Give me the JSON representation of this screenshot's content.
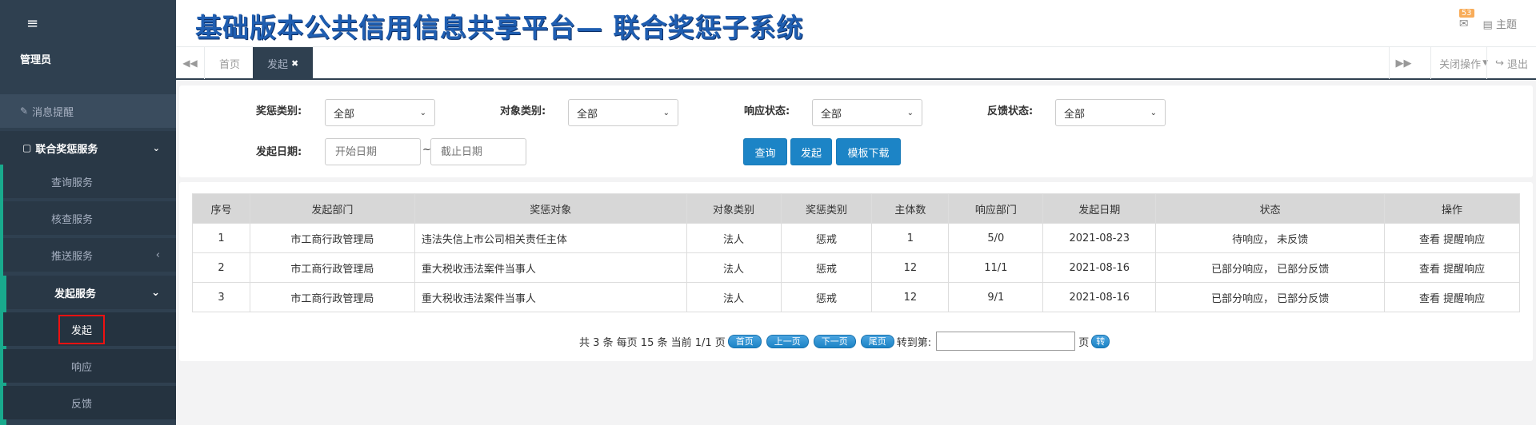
{
  "header": {
    "title": "基础版本公共信用信息共享平台— 联合奖惩子系统",
    "mail_badge": "53",
    "theme_label": "主题"
  },
  "sidebar": {
    "toggle_icon": "hamburger-icon",
    "user": "管理员",
    "message": "消息提醒",
    "group": "联合奖惩服务",
    "items": [
      "查询服务",
      "核查服务",
      "推送服务"
    ],
    "subgroup": "发起服务",
    "subitems": [
      "发起",
      "响应",
      "反馈"
    ]
  },
  "tabs": {
    "items": [
      "首页",
      "发起"
    ],
    "close_ops": "关闭操作",
    "logout": "退出"
  },
  "filter": {
    "reward_type_label": "奖惩类别:",
    "reward_type_value": "全部",
    "target_type_label": "对象类别:",
    "target_type_value": "全部",
    "response_status_label": "响应状态:",
    "response_status_value": "全部",
    "feedback_status_label": "反馈状态:",
    "feedback_status_value": "全部",
    "date_label": "发起日期:",
    "start_placeholder": "开始日期",
    "end_placeholder": "截止日期",
    "tilde": "~",
    "query_btn": "查询",
    "initiate_btn": "发起",
    "template_btn": "模板下载"
  },
  "table": {
    "headers": [
      "序号",
      "发起部门",
      "奖惩对象",
      "对象类别",
      "奖惩类别",
      "主体数",
      "响应部门",
      "发起日期",
      "状态",
      "操作"
    ],
    "rows": [
      [
        "1",
        "市工商行政管理局",
        "违法失信上市公司相关责任主体",
        "法人",
        "惩戒",
        "1",
        "5/0",
        "2021-08-23",
        "待响应， 未反馈",
        "查看 提醒响应"
      ],
      [
        "2",
        "市工商行政管理局",
        "重大税收违法案件当事人",
        "法人",
        "惩戒",
        "12",
        "11/1",
        "2021-08-16",
        "已部分响应， 已部分反馈",
        "查看 提醒响应"
      ],
      [
        "3",
        "市工商行政管理局",
        "重大税收违法案件当事人",
        "法人",
        "惩戒",
        "12",
        "9/1",
        "2021-08-16",
        "已部分响应， 已部分反馈",
        "查看 提醒响应"
      ]
    ]
  },
  "pager": {
    "summary": "共 3 条 每页 15 条 当前 1/1 页",
    "first": "首页",
    "prev": "上一页",
    "next": "下一页",
    "last": "尾页",
    "goto": "转到第:",
    "page_unit": "页",
    "go": "转"
  }
}
